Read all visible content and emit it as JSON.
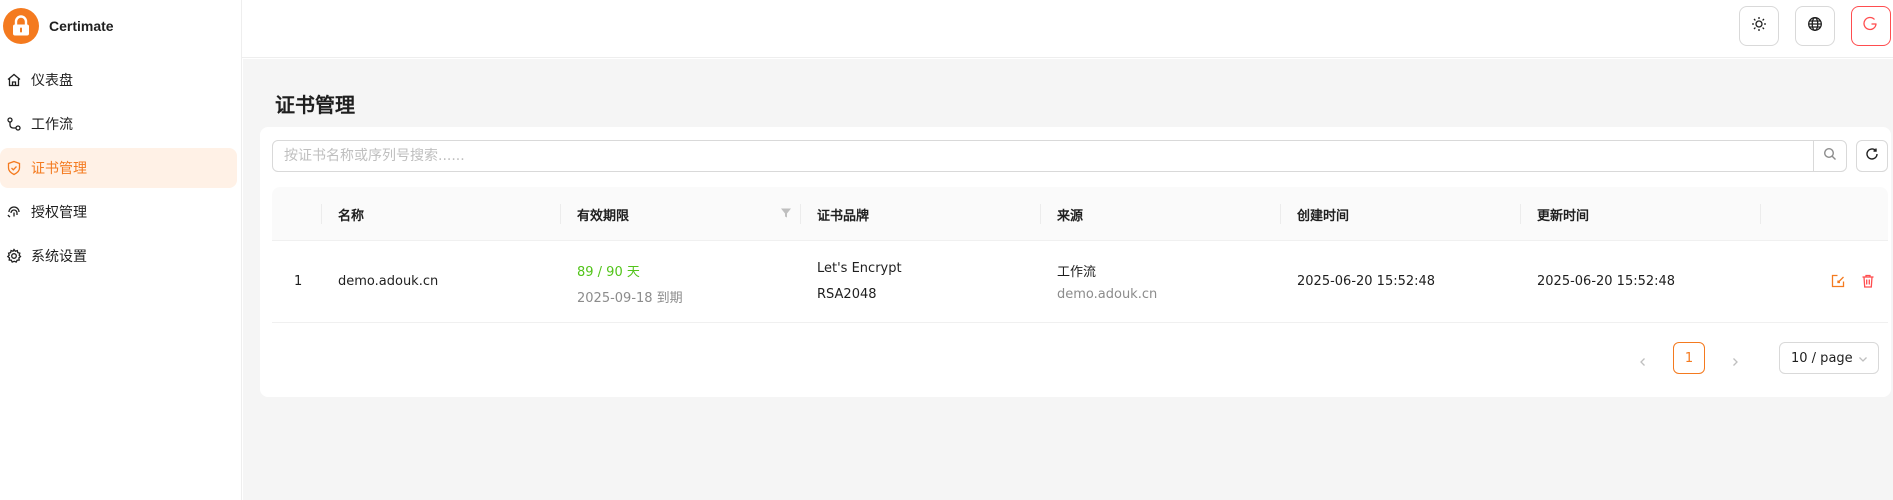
{
  "brand": {
    "name": "Certimate",
    "color": "#f47a1f"
  },
  "sidebar": {
    "items": [
      {
        "label": "仪表盘",
        "icon": "home-icon",
        "active": false
      },
      {
        "label": "工作流",
        "icon": "workflow-icon",
        "active": false
      },
      {
        "label": "证书管理",
        "icon": "shield-check-icon",
        "active": true
      },
      {
        "label": "授权管理",
        "icon": "fingerprint-icon",
        "active": false
      },
      {
        "label": "系统设置",
        "icon": "gear-icon",
        "active": false
      }
    ]
  },
  "header": {
    "buttons": [
      {
        "icon": "sun-icon"
      },
      {
        "icon": "globe-icon"
      },
      {
        "icon": "logout-icon"
      }
    ]
  },
  "main": {
    "title": "证书管理",
    "search": {
      "placeholder": "按证书名称或序列号搜索......",
      "value": ""
    },
    "table": {
      "columns": [
        "名称",
        "有效期限",
        "证书品牌",
        "来源",
        "创建时间",
        "更新时间"
      ],
      "rows": [
        {
          "index": "1",
          "name": "demo.adouk.cn",
          "validity_days": "89 / 90 天",
          "expiry": "2025-09-18 到期",
          "brand": "Let's Encrypt",
          "algorithm": "RSA2048",
          "source": "工作流",
          "source_domain": "demo.adouk.cn",
          "created": "2025-06-20 15:52:48",
          "updated": "2025-06-20 15:52:48"
        }
      ]
    },
    "pagination": {
      "current_page": "1",
      "page_size": "10 / page"
    }
  },
  "colors": {
    "accent": "#f47a1f",
    "success": "#52c41a",
    "danger": "#ff4d4f"
  }
}
